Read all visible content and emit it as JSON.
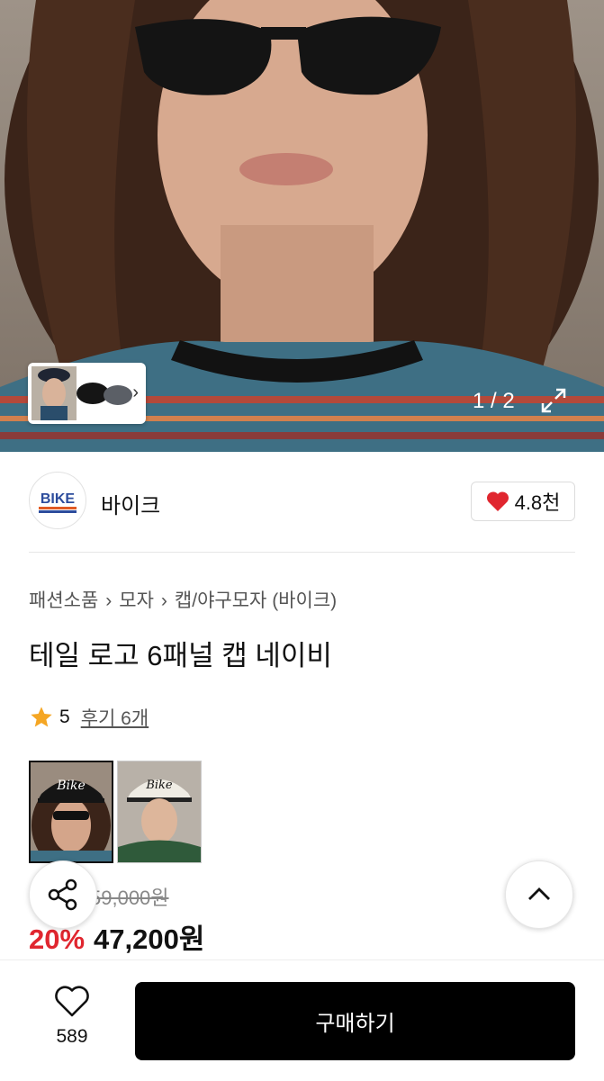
{
  "gallery": {
    "counter": "1 / 2",
    "expand_icon": "expand-icon",
    "next_icon": "chevron-right-icon"
  },
  "brand": {
    "logo_text": "BIKE",
    "name": "바이크",
    "likes": "4.8천"
  },
  "breadcrumb": [
    "패션소품",
    "모자",
    "캡/야구모자 (바이크)"
  ],
  "product": {
    "title": "테일 로고 6패널 캡 네이비",
    "rating": "5",
    "reviews_label": "후기 6개"
  },
  "variants": [
    {
      "logo": "Bike"
    },
    {
      "logo": "Bike"
    }
  ],
  "price": {
    "original": "59,000원",
    "discount": "20%",
    "sale": "47,200원"
  },
  "actions": {
    "share_icon": "share-icon",
    "top_icon": "chevron-up-icon"
  },
  "bottom": {
    "wish_count": "589",
    "buy_label": "구매하기"
  },
  "colors": {
    "accent_red": "#e0262f",
    "heart_red": "#e0262f",
    "star": "#f5a623",
    "buy_bg": "#000000"
  }
}
